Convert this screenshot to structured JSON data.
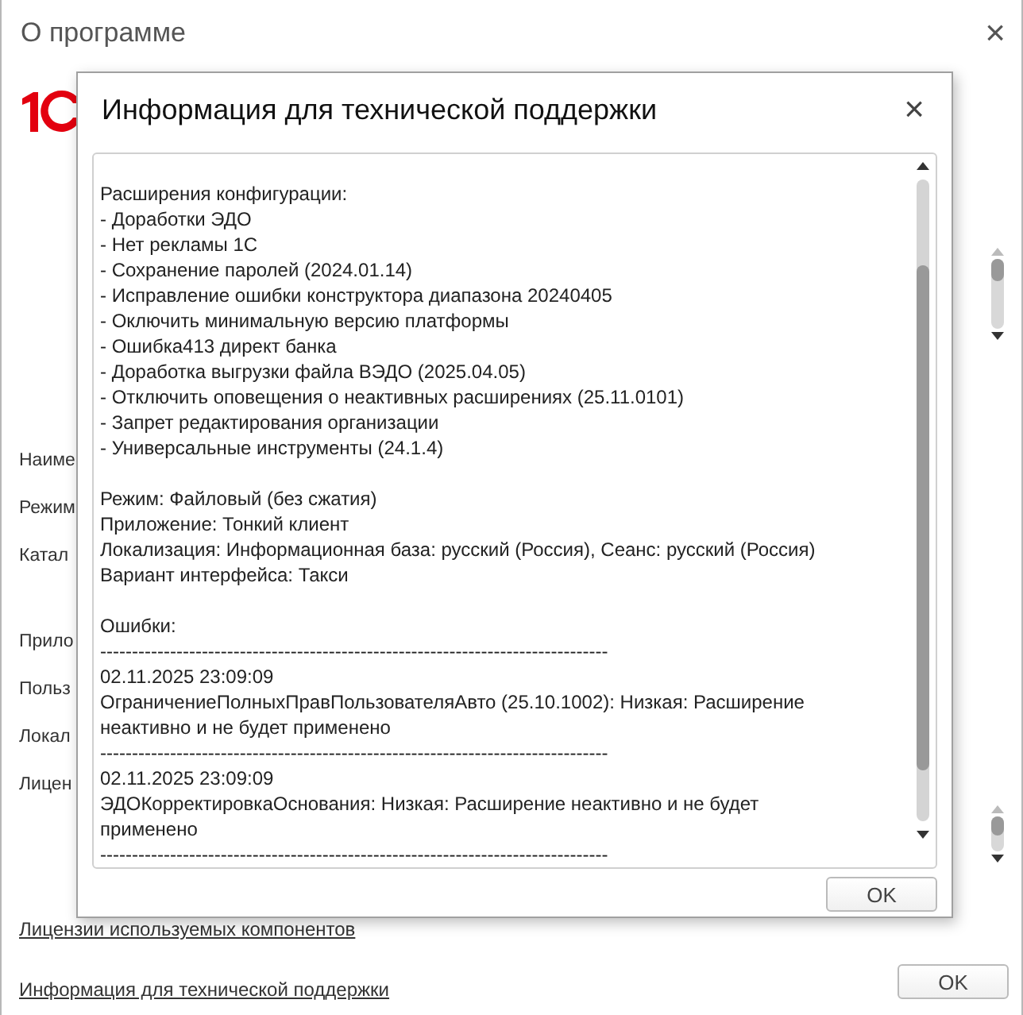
{
  "window": {
    "title": "О программе",
    "close": "×"
  },
  "field_labels_top": [
    "Наиме",
    "Режим",
    "Катал"
  ],
  "field_labels_bottom": [
    "Прило",
    "Польз",
    "Локал",
    "Лицен"
  ],
  "links": [
    "Лицензии используемых компонентов",
    "Информация для технической поддержки"
  ],
  "ok_button": "OK",
  "dialog": {
    "title": "Информация для технической поддержки",
    "close": "×",
    "sections": [
      {
        "lines": [
          "Расширения конфигурации:",
          "- Доработки ЭДО",
          "- Нет рекламы 1С",
          "- Сохранение паролей (2024.01.14)",
          "- Исправление ошибки конструктора диапазона 20240405",
          "- Оключить минимальную версию платформы",
          "- Ошибка413 директ банка",
          "- Доработка выгрузки файла ВЭДО (2025.04.05)",
          "- Отключить оповещения о неактивных расширениях (25.11.0101)",
          "- Запрет редактирования организации",
          "- Универсальные инструменты (24.1.4)"
        ]
      },
      {
        "lines": [
          "Режим: Файловый (без сжатия)",
          "Приложение: Тонкий клиент",
          "Локализация: Информационная база: русский (Россия), Сеанс: русский (Россия)",
          "Вариант интерфейса: Такси"
        ]
      },
      {
        "lines": [
          "Ошибки:"
        ]
      }
    ],
    "errors": [
      {
        "separator": "--------------------------------------------------------------------------------",
        "time": "02.11.2025 23:09:09",
        "message": "ОграничениеПолныхПравПользователяАвто (25.10.1002): Низкая: Расширение неактивно и не будет применено"
      },
      {
        "separator": "--------------------------------------------------------------------------------",
        "time": "02.11.2025 23:09:09",
        "message": "ЭДОКорректировкаОснования: Низкая: Расширение неактивно и не будет применено"
      }
    ],
    "closing_separator": "--------------------------------------------------------------------------------",
    "ok_button": "OK"
  }
}
